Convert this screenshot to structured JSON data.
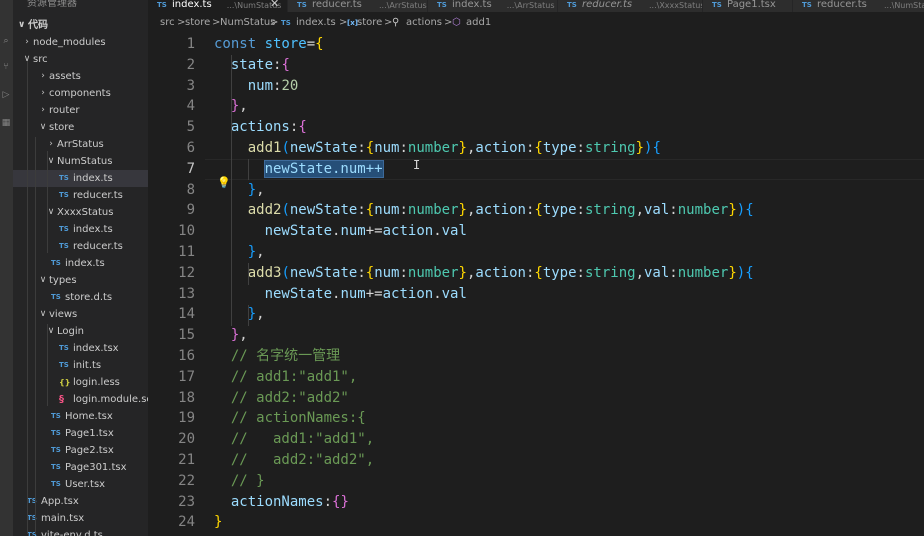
{
  "sidebar": {
    "title": "资源管理器",
    "root_label": "代码",
    "items": [
      {
        "label": "node_modules",
        "type": "folder",
        "open": false
      },
      {
        "label": "src",
        "type": "folder",
        "open": true
      },
      {
        "label": "assets",
        "type": "folder",
        "open": false
      },
      {
        "label": "components",
        "type": "folder",
        "open": false
      },
      {
        "label": "router",
        "type": "folder",
        "open": false
      },
      {
        "label": "store",
        "type": "folder",
        "open": true
      },
      {
        "label": "ArrStatus",
        "type": "folder",
        "open": false
      },
      {
        "label": "NumStatus",
        "type": "folder",
        "open": true
      },
      {
        "label": "index.ts",
        "type": "file-ts",
        "icon": "TS",
        "active": true
      },
      {
        "label": "reducer.ts",
        "type": "file-ts",
        "icon": "TS"
      },
      {
        "label": "XxxxStatus",
        "type": "folder",
        "open": true
      },
      {
        "label": "index.ts",
        "type": "file-ts",
        "icon": "TS"
      },
      {
        "label": "reducer.ts",
        "type": "file-ts",
        "icon": "TS"
      },
      {
        "label": "index.ts",
        "type": "file-ts",
        "icon": "TS"
      },
      {
        "label": "types",
        "type": "folder",
        "open": true
      },
      {
        "label": "store.d.ts",
        "type": "file-ts",
        "icon": "TS"
      },
      {
        "label": "views",
        "type": "folder",
        "open": true
      },
      {
        "label": "Login",
        "type": "folder",
        "open": true
      },
      {
        "label": "index.tsx",
        "type": "file-ts",
        "icon": "TS"
      },
      {
        "label": "init.ts",
        "type": "file-ts",
        "icon": "TS"
      },
      {
        "label": "login.less",
        "type": "file-less",
        "icon": "{}"
      },
      {
        "label": "login.module.scss",
        "type": "file-scss",
        "icon": "§"
      },
      {
        "label": "Home.tsx",
        "type": "file-ts",
        "icon": "TS"
      },
      {
        "label": "Page1.tsx",
        "type": "file-ts",
        "icon": "TS"
      },
      {
        "label": "Page2.tsx",
        "type": "file-ts",
        "icon": "TS"
      },
      {
        "label": "Page301.tsx",
        "type": "file-ts",
        "icon": "TS"
      },
      {
        "label": "User.tsx",
        "type": "file-ts",
        "icon": "TS"
      },
      {
        "label": "App.tsx",
        "type": "file-ts",
        "icon": "TS"
      },
      {
        "label": "main.tsx",
        "type": "file-ts",
        "icon": "TS"
      },
      {
        "label": "vite-env.d.ts",
        "type": "file-ts",
        "icon": "TS"
      }
    ]
  },
  "tabs": [
    {
      "icon": "TS",
      "name": "index.ts",
      "desc": "...\\NumStatus",
      "active": true,
      "close": "✕"
    },
    {
      "icon": "TS",
      "name": "reducer.ts",
      "desc": "...\\ArrStatus"
    },
    {
      "icon": "TS",
      "name": "index.ts",
      "desc": "...\\ArrStatus"
    },
    {
      "icon": "TS",
      "name": "reducer.ts",
      "desc": "...\\XxxxStatus",
      "italic": true
    },
    {
      "icon": "TS",
      "name": "Page1.tsx",
      "desc": ""
    },
    {
      "icon": "TS",
      "name": "reducer.ts",
      "desc": "...\\NumStatus"
    }
  ],
  "breadcrumb": {
    "p1": "src",
    "p2": "store",
    "p3": "NumStatus",
    "icon": "TS",
    "p4": "index.ts",
    "p5": "store",
    "p6": "actions",
    "p7": "add1",
    "sep": ">"
  },
  "editor": {
    "current_line": 7,
    "lines": [
      [
        [
          "const ",
          "kw"
        ],
        [
          "store",
          "cv"
        ],
        [
          "=",
          "op"
        ],
        [
          "{",
          "b1"
        ]
      ],
      [
        [
          "  ",
          ""
        ],
        [
          "state",
          "pr"
        ],
        [
          ":",
          "op"
        ],
        [
          "{",
          "b2"
        ]
      ],
      [
        [
          "    ",
          ""
        ],
        [
          "num",
          "pr"
        ],
        [
          ":",
          "op"
        ],
        [
          "20",
          "nu"
        ]
      ],
      [
        [
          "  ",
          ""
        ],
        [
          "}",
          "b2"
        ],
        [
          ",",
          "op"
        ]
      ],
      [
        [
          "  ",
          ""
        ],
        [
          "actions",
          "pr"
        ],
        [
          ":",
          "op"
        ],
        [
          "{",
          "b2"
        ]
      ],
      [
        [
          "    ",
          ""
        ],
        [
          "add1",
          "fn"
        ],
        [
          "(",
          "b3"
        ],
        [
          "newState",
          "pr"
        ],
        [
          ":",
          "op"
        ],
        [
          "{",
          "b1"
        ],
        [
          "num",
          "pr"
        ],
        [
          ":",
          "op"
        ],
        [
          "number",
          "ty"
        ],
        [
          "}",
          "b1"
        ],
        [
          ",",
          "op"
        ],
        [
          "action",
          "pr"
        ],
        [
          ":",
          "op"
        ],
        [
          "{",
          "b1"
        ],
        [
          "type",
          "pr"
        ],
        [
          ":",
          "op"
        ],
        [
          "string",
          "ty"
        ],
        [
          "}",
          "b1"
        ],
        [
          ")",
          "b3"
        ],
        [
          "{",
          "b3"
        ]
      ],
      [
        [
          "      ",
          ""
        ],
        [
          "newState.num++",
          "pr sel"
        ]
      ],
      [
        [
          "    ",
          ""
        ],
        [
          "}",
          "b3"
        ],
        [
          ",",
          "op"
        ]
      ],
      [
        [
          "    ",
          ""
        ],
        [
          "add2",
          "fn"
        ],
        [
          "(",
          "b3"
        ],
        [
          "newState",
          "pr"
        ],
        [
          ":",
          "op"
        ],
        [
          "{",
          "b1"
        ],
        [
          "num",
          "pr"
        ],
        [
          ":",
          "op"
        ],
        [
          "number",
          "ty"
        ],
        [
          "}",
          "b1"
        ],
        [
          ",",
          "op"
        ],
        [
          "action",
          "pr"
        ],
        [
          ":",
          "op"
        ],
        [
          "{",
          "b1"
        ],
        [
          "type",
          "pr"
        ],
        [
          ":",
          "op"
        ],
        [
          "string",
          "ty"
        ],
        [
          ",",
          "op"
        ],
        [
          "val",
          "pr"
        ],
        [
          ":",
          "op"
        ],
        [
          "number",
          "ty"
        ],
        [
          "}",
          "b1"
        ],
        [
          ")",
          "b3"
        ],
        [
          "{",
          "b3"
        ]
      ],
      [
        [
          "      ",
          ""
        ],
        [
          "newState",
          "pr"
        ],
        [
          ".",
          "op"
        ],
        [
          "num",
          "pr"
        ],
        [
          "+=",
          "op"
        ],
        [
          "action",
          "pr"
        ],
        [
          ".",
          "op"
        ],
        [
          "val",
          "pr"
        ]
      ],
      [
        [
          "    ",
          ""
        ],
        [
          "}",
          "b3"
        ],
        [
          ",",
          "op"
        ]
      ],
      [
        [
          "    ",
          ""
        ],
        [
          "add3",
          "fn"
        ],
        [
          "(",
          "b3"
        ],
        [
          "newState",
          "pr"
        ],
        [
          ":",
          "op"
        ],
        [
          "{",
          "b1"
        ],
        [
          "num",
          "pr"
        ],
        [
          ":",
          "op"
        ],
        [
          "number",
          "ty"
        ],
        [
          "}",
          "b1"
        ],
        [
          ",",
          "op"
        ],
        [
          "action",
          "pr"
        ],
        [
          ":",
          "op"
        ],
        [
          "{",
          "b1"
        ],
        [
          "type",
          "pr"
        ],
        [
          ":",
          "op"
        ],
        [
          "string",
          "ty"
        ],
        [
          ",",
          "op"
        ],
        [
          "val",
          "pr"
        ],
        [
          ":",
          "op"
        ],
        [
          "number",
          "ty"
        ],
        [
          "}",
          "b1"
        ],
        [
          ")",
          "b3"
        ],
        [
          "{",
          "b3"
        ]
      ],
      [
        [
          "      ",
          ""
        ],
        [
          "newState",
          "pr"
        ],
        [
          ".",
          "op"
        ],
        [
          "num",
          "pr"
        ],
        [
          "+=",
          "op"
        ],
        [
          "action",
          "pr"
        ],
        [
          ".",
          "op"
        ],
        [
          "val",
          "pr"
        ]
      ],
      [
        [
          "    ",
          ""
        ],
        [
          "}",
          "b3"
        ],
        [
          ",",
          "op"
        ]
      ],
      [
        [
          "  ",
          ""
        ],
        [
          "}",
          "b2"
        ],
        [
          ",",
          "op"
        ]
      ],
      [
        [
          "  ",
          ""
        ],
        [
          "// 名字统一管理",
          "cm"
        ]
      ],
      [
        [
          "  ",
          ""
        ],
        [
          "// add1:\"add1\",",
          "cm"
        ]
      ],
      [
        [
          "  ",
          ""
        ],
        [
          "// add2:\"add2\"",
          "cm"
        ]
      ],
      [
        [
          "  ",
          ""
        ],
        [
          "// actionNames:{",
          "cm"
        ]
      ],
      [
        [
          "  ",
          ""
        ],
        [
          "//   add1:\"add1\",",
          "cm"
        ]
      ],
      [
        [
          "  ",
          ""
        ],
        [
          "//   add2:\"add2\",",
          "cm"
        ]
      ],
      [
        [
          "  ",
          ""
        ],
        [
          "// }",
          "cm"
        ]
      ],
      [
        [
          "  ",
          ""
        ],
        [
          "actionNames",
          "pr"
        ],
        [
          ":",
          "op"
        ],
        [
          "{}",
          "b2"
        ]
      ],
      [
        [
          "}",
          "b1"
        ]
      ]
    ]
  }
}
